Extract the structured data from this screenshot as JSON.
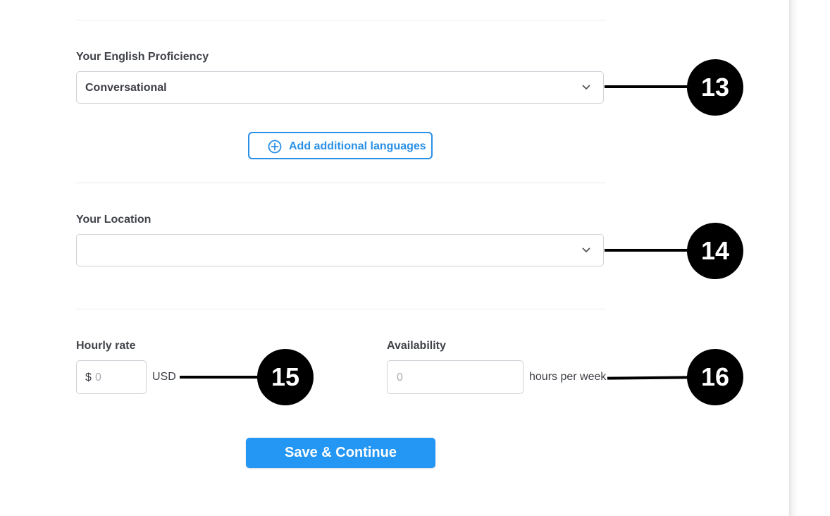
{
  "english": {
    "label": "Your English Proficiency",
    "selected": "Conversational"
  },
  "add_languages": {
    "label": "Add additional languages"
  },
  "location": {
    "label": "Your Location",
    "selected": ""
  },
  "hourly_rate": {
    "label": "Hourly rate",
    "prefix": "$",
    "placeholder": "0",
    "unit": "USD"
  },
  "availability": {
    "label": "Availability",
    "placeholder": "0",
    "unit": "hours per week"
  },
  "save_button": {
    "label": "Save & Continue"
  },
  "callouts": [
    "13",
    "14",
    "15",
    "16"
  ],
  "colors": {
    "accent": "#2496f3",
    "outline_accent": "#2a90e6",
    "border": "#cfd1d6",
    "badge": "#000000"
  }
}
